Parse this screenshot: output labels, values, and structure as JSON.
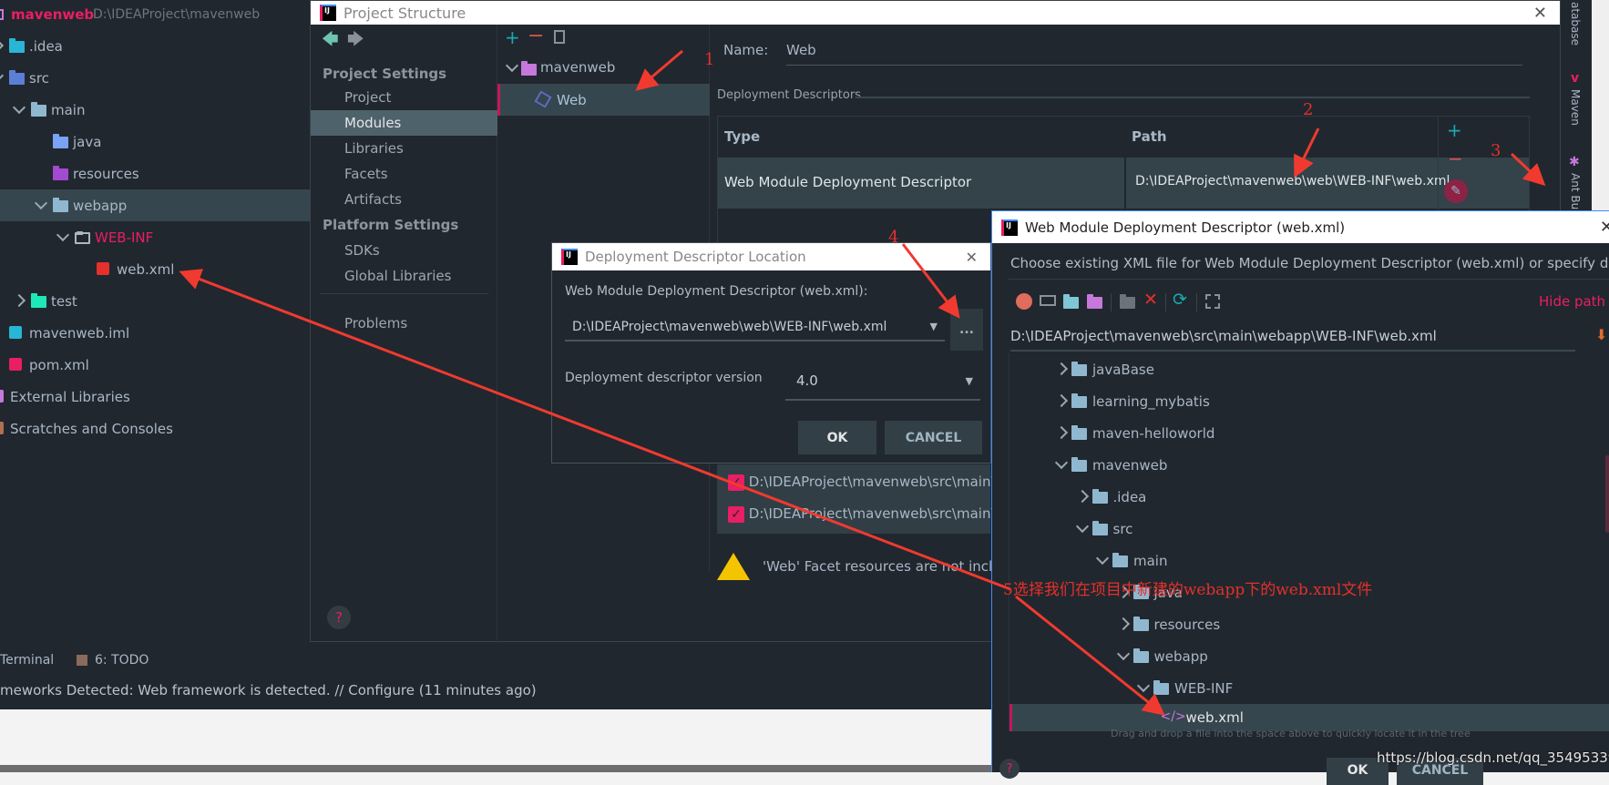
{
  "project_tree": {
    "root_name": "mavenweb",
    "root_path": "D:\\IDEAProject\\mavenweb",
    "items": [
      {
        "label": ".idea",
        "depth": 1,
        "chevron": "right",
        "icon": "folder",
        "color": "#29b6d6"
      },
      {
        "label": "src",
        "depth": 1,
        "chevron": "down",
        "icon": "folder",
        "color": "#5c7fd6"
      },
      {
        "label": "main",
        "depth": 2,
        "chevron": "down",
        "icon": "folder",
        "color": "#8fb8d0"
      },
      {
        "label": "java",
        "depth": 3,
        "chevron": "",
        "icon": "folder",
        "color": "#7aa2f7"
      },
      {
        "label": "resources",
        "depth": 3,
        "chevron": "",
        "icon": "folder",
        "color": "#a24bd1"
      },
      {
        "label": "webapp",
        "depth": 3,
        "chevron": "down",
        "icon": "folder",
        "color": "#8fb8d0",
        "selected": true
      },
      {
        "label": "WEB-INF",
        "depth": 4,
        "chevron": "down",
        "icon": "folder-outline",
        "color": "#e91e63",
        "text_color": "#e91e63"
      },
      {
        "label": "web.xml",
        "depth": 5,
        "chevron": "",
        "icon": "xml-file",
        "color": "#e5302b"
      },
      {
        "label": "test",
        "depth": 2,
        "chevron": "right",
        "icon": "folder",
        "color": "#1de9b6"
      },
      {
        "label": "mavenweb.iml",
        "depth": 1,
        "chevron": "",
        "icon": "iml-file",
        "color": "#29b6d6"
      },
      {
        "label": "pom.xml",
        "depth": 1,
        "chevron": "",
        "icon": "maven-file",
        "color": "#e91e63"
      },
      {
        "label": "External Libraries",
        "depth": 0,
        "chevron": "",
        "icon": "library",
        "color": "#c678dd"
      },
      {
        "label": "Scratches and Consoles",
        "depth": 0,
        "chevron": "",
        "icon": "scratches",
        "color": "#b07050"
      }
    ]
  },
  "bottom_bar": {
    "terminal": "Terminal",
    "todo": "6: TODO",
    "status": "meworks Detected: Web framework is detected. // Configure (11 minutes ago)"
  },
  "right_strip": {
    "items": [
      "atabase",
      "Maven",
      "Ant Bu"
    ]
  },
  "project_structure": {
    "title": "Project Structure",
    "nav": [
      {
        "label": "Project Settings",
        "type": "header"
      },
      {
        "label": "Project"
      },
      {
        "label": "Modules",
        "selected": true
      },
      {
        "label": "Libraries"
      },
      {
        "label": "Facets"
      },
      {
        "label": "Artifacts"
      },
      {
        "label": "Platform Settings",
        "type": "header"
      },
      {
        "label": "SDKs"
      },
      {
        "label": "Global Libraries"
      },
      {
        "label": "Problems"
      }
    ],
    "modules": {
      "root": "mavenweb",
      "child": "Web"
    },
    "name_label": "Name:",
    "name_value": "Web",
    "descriptors_title": "Deployment Descriptors",
    "table": {
      "columns": [
        "Type",
        "Path"
      ],
      "rows": [
        [
          "Web Module Deployment Descriptor",
          "D:\\IDEAProject\\mavenweb\\web\\WEB-INF\\web.xml"
        ]
      ]
    },
    "resource_dirs": [
      "D:\\IDEAProject\\mavenweb\\src\\main\\",
      "D:\\IDEAProject\\mavenweb\\src\\main\\"
    ],
    "warning": "'Web' Facet resources are not inclu"
  },
  "location_dialog": {
    "title": "Deployment Descriptor Location",
    "descriptor_label": "Web Module Deployment Descriptor (web.xml):",
    "descriptor_value": "D:\\IDEAProject\\mavenweb\\web\\WEB-INF\\web.xml",
    "browse": "...",
    "version_label": "Deployment descriptor version",
    "version_value": "4.0",
    "ok": "OK",
    "cancel": "CANCEL"
  },
  "chooser_dialog": {
    "title": "Web Module Deployment Descriptor (web.xml)",
    "description": "Choose existing XML file for Web Module Deployment Descriptor (web.xml) or specify di...",
    "hide_path": "Hide path",
    "path": "D:\\IDEAProject\\mavenweb\\src\\main\\webapp\\WEB-INF\\web.xml",
    "tree": [
      {
        "label": "javaBase",
        "depth": 1,
        "chevron": "right"
      },
      {
        "label": "learning_mybatis",
        "depth": 1,
        "chevron": "right"
      },
      {
        "label": "maven-helloworld",
        "depth": 1,
        "chevron": "right"
      },
      {
        "label": "mavenweb",
        "depth": 1,
        "chevron": "down"
      },
      {
        "label": ".idea",
        "depth": 2,
        "chevron": "right"
      },
      {
        "label": "src",
        "depth": 2,
        "chevron": "down"
      },
      {
        "label": "main",
        "depth": 3,
        "chevron": "down"
      },
      {
        "label": "java",
        "depth": 4,
        "chevron": "right"
      },
      {
        "label": "resources",
        "depth": 4,
        "chevron": "right"
      },
      {
        "label": "webapp",
        "depth": 4,
        "chevron": "down"
      },
      {
        "label": "WEB-INF",
        "depth": 5,
        "chevron": "down"
      },
      {
        "label": "web.xml",
        "depth": 6,
        "chevron": "",
        "file": true,
        "selected": true
      }
    ],
    "hint": "Drag and drop a file into the space above to quickly locate it in the tree",
    "ok": "OK",
    "cancel": "CANCEL"
  },
  "annotations": {
    "steps": [
      "1",
      "2",
      "3",
      "4"
    ],
    "step5": "5选择我们在项目中新建的webapp下的web.xml文件",
    "color": "#e5302b"
  },
  "watermark": "https://blog.csdn.net/qq_35495339",
  "accent": "#e91e63"
}
